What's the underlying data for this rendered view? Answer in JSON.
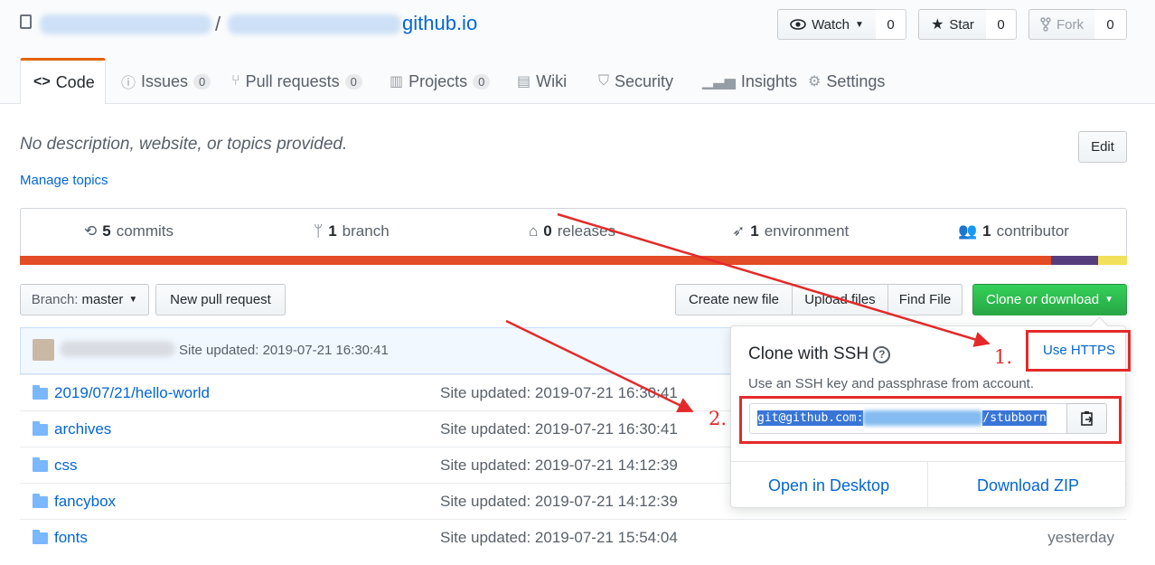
{
  "repo": {
    "owner": "",
    "name_visible": "github.io",
    "separator": "/"
  },
  "actions": [
    {
      "label": "Watch",
      "count": "0",
      "icon": "eye-icon"
    },
    {
      "label": "Star",
      "count": "0",
      "icon": "star-icon"
    },
    {
      "label": "Fork",
      "count": "0",
      "icon": "fork-icon"
    }
  ],
  "tabs": [
    {
      "label": "Code",
      "icon": "code-icon",
      "count": null
    },
    {
      "label": "Issues",
      "icon": "issue-icon",
      "count": "0"
    },
    {
      "label": "Pull requests",
      "icon": "pull-request-icon",
      "count": "0"
    },
    {
      "label": "Projects",
      "icon": "project-icon",
      "count": "0"
    },
    {
      "label": "Wiki",
      "icon": "book-icon",
      "count": null
    },
    {
      "label": "Security",
      "icon": "shield-icon",
      "count": null
    },
    {
      "label": "Insights",
      "icon": "graph-icon",
      "count": null
    },
    {
      "label": "Settings",
      "icon": "gear-icon",
      "count": null
    }
  ],
  "description": {
    "text": "No description, website, or topics provided.",
    "edit": "Edit",
    "manage_topics": "Manage topics"
  },
  "summary": [
    {
      "num": "5",
      "label": "commits",
      "icon": "history-icon"
    },
    {
      "num": "1",
      "label": "branch",
      "icon": "branch-icon"
    },
    {
      "num": "0",
      "label": "releases",
      "icon": "tag-icon"
    },
    {
      "num": "1",
      "label": "environment",
      "icon": "rocket-icon"
    },
    {
      "num": "1",
      "label": "contributor",
      "icon": "people-icon"
    }
  ],
  "language_colors": [
    "#e34c26",
    "#563d7c",
    "#f1e05a"
  ],
  "filenav": {
    "branch_prefix": "Branch:",
    "branch": "master",
    "new_pr": "New pull request",
    "create_file": "Create new file",
    "upload_files": "Upload files",
    "find_file": "Find File",
    "clone": "Clone or download"
  },
  "latest_commit": {
    "message": "Site updated: 2019-07-21 16:30:41"
  },
  "files": [
    {
      "name": "2019/07/21/hello-world",
      "message": "Site updated: 2019-07-21 16:30:41",
      "age": ""
    },
    {
      "name": "archives",
      "message": "Site updated: 2019-07-21 16:30:41",
      "age": ""
    },
    {
      "name": "css",
      "message": "Site updated: 2019-07-21 14:12:39",
      "age": ""
    },
    {
      "name": "fancybox",
      "message": "Site updated: 2019-07-21 14:12:39",
      "age": ""
    },
    {
      "name": "fonts",
      "message": "Site updated: 2019-07-21 15:54:04",
      "age": "yesterday"
    }
  ],
  "clone_popover": {
    "title": "Clone with SSH",
    "use_https": "Use HTTPS",
    "hint": "Use an SSH key and passphrase from account.",
    "url_start": "git@github.com:",
    "url_end": "/stubborn",
    "open_desktop": "Open in Desktop",
    "download_zip": "Download ZIP"
  },
  "annotations": {
    "step1": "1.",
    "step2": "2.",
    "color": "#e32a2a"
  }
}
